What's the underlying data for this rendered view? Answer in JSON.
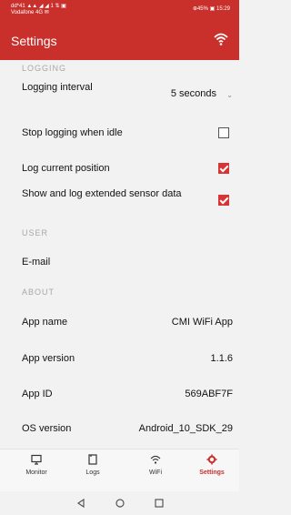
{
  "status_bar": {
    "left_text": "dd*41 ▲▲ ◢ ◢ 1 ⇅ ▣",
    "left_text_line2": "Vodafone 4G ✉",
    "right_text": "⊕45% ▣ 15:29"
  },
  "app_bar": {
    "title": "Settings",
    "icon": "wifi-icon"
  },
  "sections": {
    "logging": {
      "header": "LOGGING",
      "logging_interval_label": "Logging interval",
      "logging_interval_value": "5 seconds",
      "stop_logging_idle_label": "Stop logging when idle",
      "stop_logging_idle_checked": false,
      "log_position_label": "Log current position",
      "log_position_checked": true,
      "extended_sensor_label": "Show and log extended sensor data",
      "extended_sensor_checked": true
    },
    "user": {
      "header": "USER",
      "email_label": "E-mail"
    },
    "about": {
      "header": "ABOUT",
      "app_name_label": "App name",
      "app_name_value": "CMI WiFi App",
      "app_version_label": "App version",
      "app_version_value": "1.1.6",
      "app_id_label": "App ID",
      "app_id_value": "569ABF7F",
      "os_version_label": "OS version",
      "os_version_value": "Android_10_SDK_29"
    }
  },
  "bottom_nav": {
    "items": [
      {
        "label": "Monitor",
        "icon": "monitor-icon",
        "active": false
      },
      {
        "label": "Logs",
        "icon": "logs-icon",
        "active": false
      },
      {
        "label": "WiFi",
        "icon": "wifi-icon",
        "active": false
      },
      {
        "label": "Settings",
        "icon": "gear-icon",
        "active": true
      }
    ]
  },
  "colors": {
    "accent": "#c9302c",
    "checkbox_checked": "#d93434",
    "section_header": "#a8a8a8"
  }
}
